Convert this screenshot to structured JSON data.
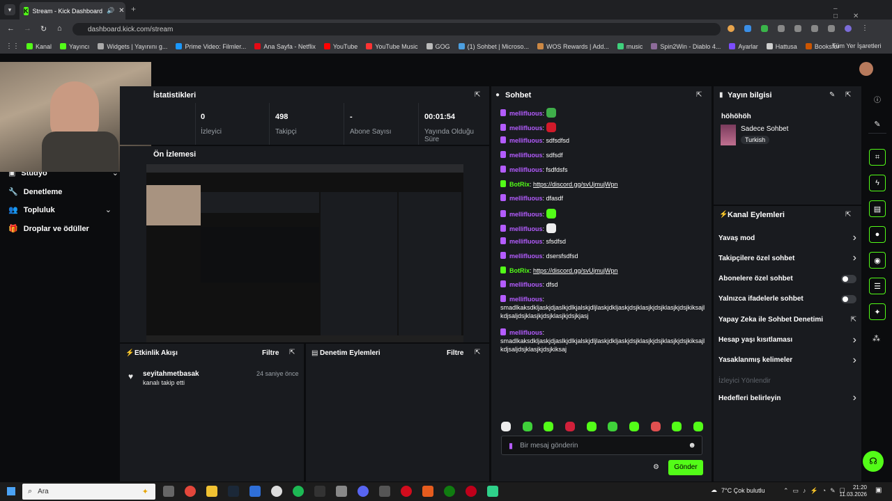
{
  "browser": {
    "tab_title": "Stream - Kick Dashboard",
    "url": "dashboard.kick.com/stream",
    "bookmarks": [
      "Kanal",
      "Yayıncı",
      "Widgets | Yayınını g...",
      "Prime Video: Filmler...",
      "Ana Sayfa - Netflix",
      "YouTube",
      "YouTube Music",
      "GOG",
      "(1) Sohbet | Microso...",
      "WOS Rewards | Add...",
      "music",
      "Spin2Win - Diablo 4...",
      "Ayarlar",
      "Hattusa",
      "Booksfer"
    ],
    "all_bookmarks": "Tüm Yer İşaretleri"
  },
  "sidebar": {
    "items": [
      {
        "label": "Stüdyo",
        "icon": "studio-icon"
      },
      {
        "label": "Denetleme",
        "icon": "wrench-icon"
      },
      {
        "label": "Topluluk",
        "icon": "people-icon"
      },
      {
        "label": "Droplar ve ödüller",
        "icon": "gift-icon"
      }
    ]
  },
  "stats": {
    "title": "İstatistikleri",
    "items": [
      {
        "value": "0",
        "label": "İzleyici"
      },
      {
        "value": "498",
        "label": "Takipçi"
      },
      {
        "value": "-",
        "label": "Abone Sayısı"
      },
      {
        "value": "00:01:54",
        "label": "Yayında Olduğu Süre"
      }
    ]
  },
  "preview": {
    "title": "Ön İzlemesi"
  },
  "activity": {
    "title": "Etkinlik Akışı",
    "filter": "Filtre",
    "events": [
      {
        "user": "seyitahmetbasak",
        "action": "kanalı takip etti",
        "time": "24 saniye önce"
      }
    ]
  },
  "moderation": {
    "title": "Denetim Eylemleri",
    "filter": "Filtre"
  },
  "chat": {
    "title": "Sohbet",
    "messages": [
      {
        "user": "mellifluous",
        "text": "",
        "emote": "frog"
      },
      {
        "user": "mellifluous",
        "text": "",
        "emote": "red"
      },
      {
        "user": "mellifluous",
        "text": "sdfsdfsd"
      },
      {
        "user": "mellifluous",
        "text": "sdfsdf"
      },
      {
        "user": "mellifluous",
        "text": "fsdfdsfs"
      },
      {
        "user": "BotRix",
        "text": "https://discord.gg/svUjmujWpn",
        "bot": true
      },
      {
        "user": "mellifluous",
        "text": "dfasdf"
      },
      {
        "user": "mellifluous",
        "text": "",
        "emote": "green"
      },
      {
        "user": "mellifluous",
        "text": "",
        "emote": "skull"
      },
      {
        "user": "mellifluous",
        "text": "sfsdfsd"
      },
      {
        "user": "mellifluous",
        "text": "dsersfsdfsd"
      },
      {
        "user": "BotRix",
        "text": "https://discord.gg/svUjmujWpn",
        "bot": true
      },
      {
        "user": "mellifluous",
        "text": "dfsd"
      },
      {
        "user": "mellifluous",
        "text": "smadlkaksdkljaskjdjaslkjdlkjalskjdljlaskjdkljaskjdsjklasjkjdsjklasjkjdsjkiksajlkdjsaljdsjklasjkjdsjklasjkjdsjkjasj",
        "wrap": true
      },
      {
        "user": "mellifluous",
        "text": "smadlkaksdkljaskjdjaslkjdlkjalskjdljlaskjdkljaskjdsjklasjkjdsjklasjkjdsjkiksajlkdjsaljdsjklasjkjdsjkiksaj",
        "wrap": true
      }
    ],
    "input_placeholder": "Bir mesaj gönderin",
    "send": "Gönder"
  },
  "stream_info": {
    "title": "Yayın bilgisi",
    "stream_title": "höhöhöh",
    "category": "Sadece Sohbet",
    "language": "Turkish"
  },
  "channel_actions": {
    "title": "Kanal Eylemleri",
    "items": [
      {
        "label": "Yavaş mod",
        "control": "chevron"
      },
      {
        "label": "Takipçilere özel sohbet",
        "control": "chevron"
      },
      {
        "label": "Abonelere özel sohbet",
        "control": "toggle"
      },
      {
        "label": "Yalnızca ifadelerle sohbet",
        "control": "toggle"
      },
      {
        "label": "Yapay Zeka ile Sohbet Denetimi",
        "control": "external"
      },
      {
        "label": "Hesap yaşı kısıtlaması",
        "control": "chevron"
      },
      {
        "label": "Yasaklanmış kelimeler",
        "control": "chevron"
      },
      {
        "label": "İzleyici Yönlendir",
        "control": "none",
        "disabled": true
      },
      {
        "label": "Hedefleri belirleyin",
        "control": "chevron"
      }
    ]
  },
  "taskbar": {
    "search": "Ara",
    "weather": "7°C  Çok bulutlu",
    "time": "21:20",
    "date": "11.03.2026"
  },
  "colors": {
    "accent": "#53fc18",
    "username": "#b45cff",
    "panel": "#191b1f",
    "bg": "#0b0c0e"
  }
}
